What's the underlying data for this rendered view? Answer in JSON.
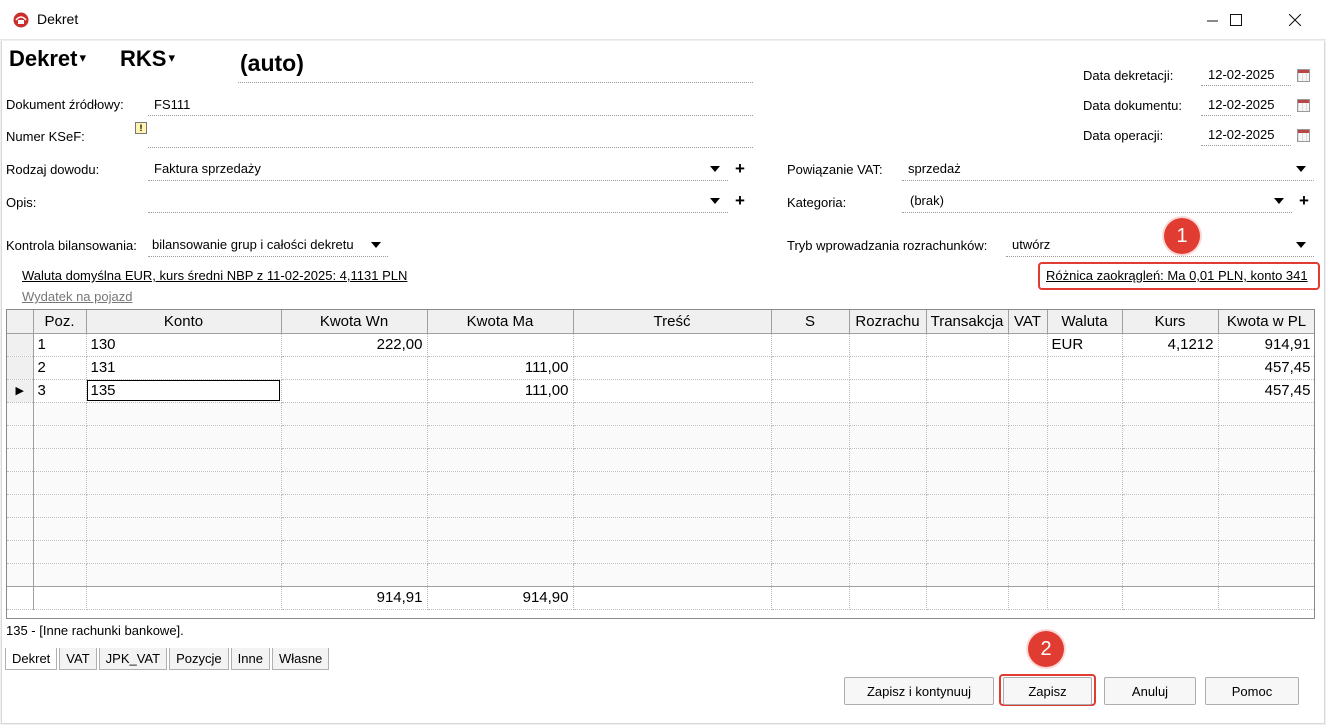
{
  "window": {
    "title": "Dekret"
  },
  "header": {
    "doc_type": "Dekret",
    "register": "RKS",
    "number": "(auto)"
  },
  "fields": {
    "dokument_label": "Dokument źródłowy:",
    "dokument_value": "FS111",
    "ksef_label": "Numer KSeF:",
    "rodzaj_label": "Rodzaj dowodu:",
    "rodzaj_value": "Faktura sprzedaży",
    "opis_label": "Opis:",
    "opis_value": "",
    "kontrola_label": "Kontrola bilansowania:",
    "kontrola_value": "bilansowanie grup i całości dekretu",
    "data_dekretacji_label": "Data dekretacji:",
    "data_dekretacji": "12-02-2025",
    "data_dokumentu_label": "Data dokumentu:",
    "data_dokumentu": "12-02-2025",
    "data_operacji_label": "Data operacji:",
    "data_operacji": "12-02-2025",
    "powiazanie_label": "Powiązanie VAT:",
    "powiazanie_value": "sprzedaż",
    "kategoria_label": "Kategoria:",
    "kategoria_value": "(brak)",
    "tryb_label": "Tryb wprowadzania rozrachunków:",
    "tryb_value": "utwórz"
  },
  "links": {
    "waluta": "Waluta domyślna EUR, kurs średni NBP z 11-02-2025: 4,1131 PLN",
    "wydatek": "Wydatek na pojazd",
    "roznica": "Różnica zaokrągleń: Ma 0,01 PLN, konto 341"
  },
  "badges": {
    "one": "1",
    "two": "2"
  },
  "grid": {
    "columns": [
      "Poz.",
      "Konto",
      "Kwota Wn",
      "Kwota Ma",
      "Treść",
      "S",
      "Rozrachu",
      "Transakcja",
      "VAT",
      "Waluta",
      "Kurs",
      "Kwota w PL"
    ],
    "rows": [
      {
        "poz": "1",
        "konto": "130",
        "wn": "222,00",
        "ma": "",
        "waluta": "EUR",
        "kurs": "4,1212",
        "pln": "914,91"
      },
      {
        "poz": "2",
        "konto": "131",
        "wn": "",
        "ma": "111,00",
        "waluta": "",
        "kurs": "",
        "pln": "457,45"
      },
      {
        "poz": "3",
        "konto": "135",
        "wn": "",
        "ma": "111,00",
        "waluta": "",
        "kurs": "",
        "pln": "457,45"
      }
    ],
    "sum_wn": "914,91",
    "sum_ma": "914,90"
  },
  "status_text": "135 - [Inne rachunki bankowe].",
  "tabs": [
    "Dekret",
    "VAT",
    "JPK_VAT",
    "Pozycje",
    "Inne",
    "Własne"
  ],
  "buttons": {
    "save_continue": "Zapisz i kontynuuj",
    "save": "Zapisz",
    "cancel": "Anuluj",
    "help": "Pomoc"
  },
  "colors": {
    "highlight": "#e03c31"
  }
}
